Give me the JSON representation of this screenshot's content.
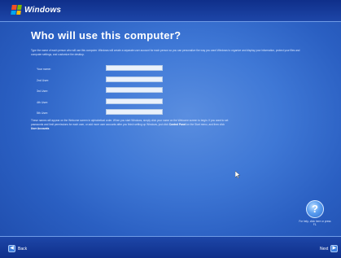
{
  "header": {
    "logo_text": "Windows"
  },
  "main": {
    "title": "Who will use this computer?",
    "intro": "Type the name of each person who will use this computer. Windows will create a separate user account for each person so you can personalize the way you want Windows to organize and display your information, protect your files and computer settings, and customize the desktop.",
    "fields": [
      {
        "label": "Your name:",
        "value": ""
      },
      {
        "label": "2nd User:",
        "value": ""
      },
      {
        "label": "3rd User:",
        "value": ""
      },
      {
        "label": "4th User:",
        "value": ""
      },
      {
        "label": "5th User:",
        "value": ""
      }
    ],
    "notes": "These names will appear on the Welcome screen in alphabetical order. When you start Windows, simply click your name on the Welcome screen to begin. If you want to set passwords and limit permissions for each user, or add more user accounts after you finish setting up Windows, just click",
    "notes_link1": "Control Panel",
    "notes_mid": "on the Start menu, and then click",
    "notes_link2": "User Accounts"
  },
  "help": {
    "icon": "help-icon",
    "label": "For help, click here or press F1."
  },
  "footer": {
    "back_label": "Back",
    "next_label": "Next"
  }
}
